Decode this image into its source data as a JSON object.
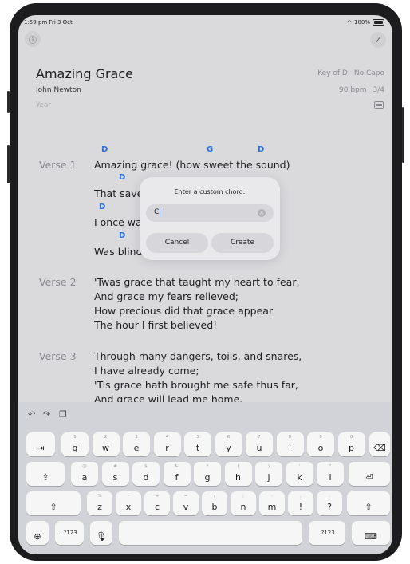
{
  "status": {
    "time": "1:59 pm  Fri 3 Oct",
    "battery": "100%"
  },
  "song": {
    "title": "Amazing Grace",
    "author": "John Newton",
    "year_placeholder": "Year",
    "key": "Key of D",
    "capo": "No Capo",
    "bpm": "90 bpm",
    "time_signature": "3/4"
  },
  "verses": [
    {
      "label": "Verse 1",
      "lines": [
        "Amazing grace! (how sweet the sound)",
        "That save",
        "I once wa",
        "Was blind"
      ]
    },
    {
      "label": "Verse 2",
      "lines": [
        "'Twas grace that taught my heart to fear,",
        "And grace my fears relieved;",
        "How precious did that grace appear",
        "The hour I first believed!"
      ]
    },
    {
      "label": "Verse 3",
      "lines": [
        "Through many dangers, toils, and snares,",
        "I have already come;",
        "'Tis grace hath brought me safe thus far,",
        "And grace will lead me home."
      ]
    }
  ],
  "chords": {
    "d": "D",
    "g": "G"
  },
  "dialog": {
    "title": "Enter a custom chord:",
    "value": "C",
    "cancel": "Cancel",
    "create": "Create"
  },
  "keyboard": {
    "row1": [
      [
        "q",
        "1"
      ],
      [
        "w",
        "2"
      ],
      [
        "e",
        "3"
      ],
      [
        "r",
        "4"
      ],
      [
        "t",
        "5"
      ],
      [
        "y",
        "6"
      ],
      [
        "u",
        "7"
      ],
      [
        "i",
        "8"
      ],
      [
        "o",
        "9"
      ],
      [
        "p",
        "0"
      ]
    ],
    "row2": [
      [
        "a",
        "@"
      ],
      [
        "s",
        "#"
      ],
      [
        "d",
        "$"
      ],
      [
        "f",
        "&"
      ],
      [
        "g",
        "*"
      ],
      [
        "h",
        "("
      ],
      [
        "j",
        ")"
      ],
      [
        "k",
        "'"
      ],
      [
        "l",
        "\""
      ]
    ],
    "row3": [
      [
        "z",
        "%"
      ],
      [
        "x",
        "-"
      ],
      [
        "c",
        "+"
      ],
      [
        "v",
        "="
      ],
      [
        "b",
        "/"
      ],
      [
        "n",
        ";"
      ],
      [
        "m",
        ":"
      ],
      [
        "!",
        ","
      ],
      [
        "?",
        "."
      ]
    ],
    "num_label": ".?123"
  }
}
